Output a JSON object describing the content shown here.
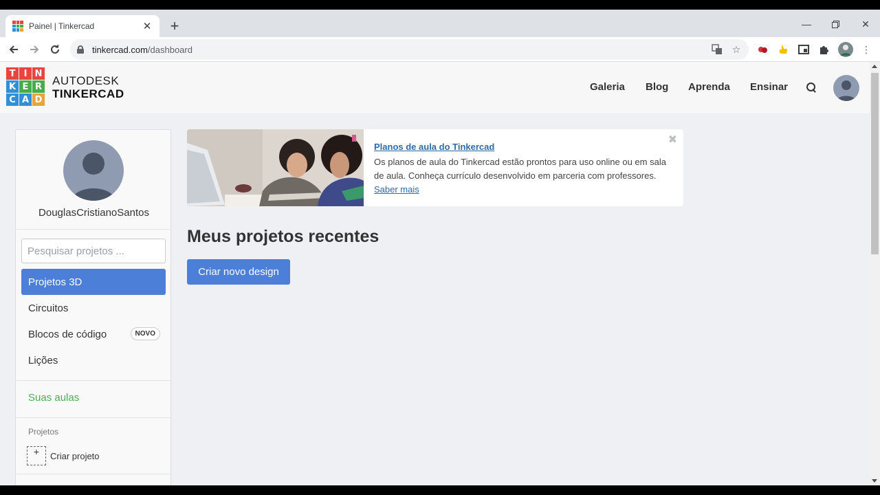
{
  "browser": {
    "tab_title": "Painel | Tinkercad",
    "url_host": "tinkercad.com",
    "url_path": "/dashboard"
  },
  "header": {
    "logo_letters": [
      "T",
      "I",
      "N",
      "K",
      "E",
      "R",
      "C",
      "A",
      "D"
    ],
    "logo_colors": [
      "#e8453c",
      "#e8453c",
      "#e8453c",
      "#2f8fd8",
      "#46ad4a",
      "#46ad4a",
      "#2f8fd8",
      "#2f8fd8",
      "#e8a33c"
    ],
    "brand_line1": "AUTODESK",
    "brand_line2": "TINKERCAD",
    "nav": [
      "Galeria",
      "Blog",
      "Aprenda",
      "Ensinar"
    ]
  },
  "sidebar": {
    "username": "DouglasCristianoSantos",
    "search_placeholder": "Pesquisar projetos ...",
    "items": [
      {
        "label": "Projetos 3D"
      },
      {
        "label": "Circuitos"
      },
      {
        "label": "Blocos de código",
        "badge": "NOVO"
      },
      {
        "label": "Lições"
      }
    ],
    "classes_label": "Suas aulas",
    "projects_caption": "Projetos",
    "create_project_label": "Criar projeto",
    "create_plus": "+"
  },
  "banner": {
    "close": "✖",
    "title": "Planos de aula do Tinkercad",
    "text": "Os planos de aula do Tinkercad estão prontos para uso online ou em sala de aula. Conheça currículo desenvolvido em parceria com professores.",
    "link": "Saber mais"
  },
  "main": {
    "section_title": "Meus projetos recentes",
    "create_button": "Criar novo design"
  },
  "colors": {
    "accent": "#4b7fd8",
    "green": "#4caf50",
    "link": "#2f6aa8"
  }
}
